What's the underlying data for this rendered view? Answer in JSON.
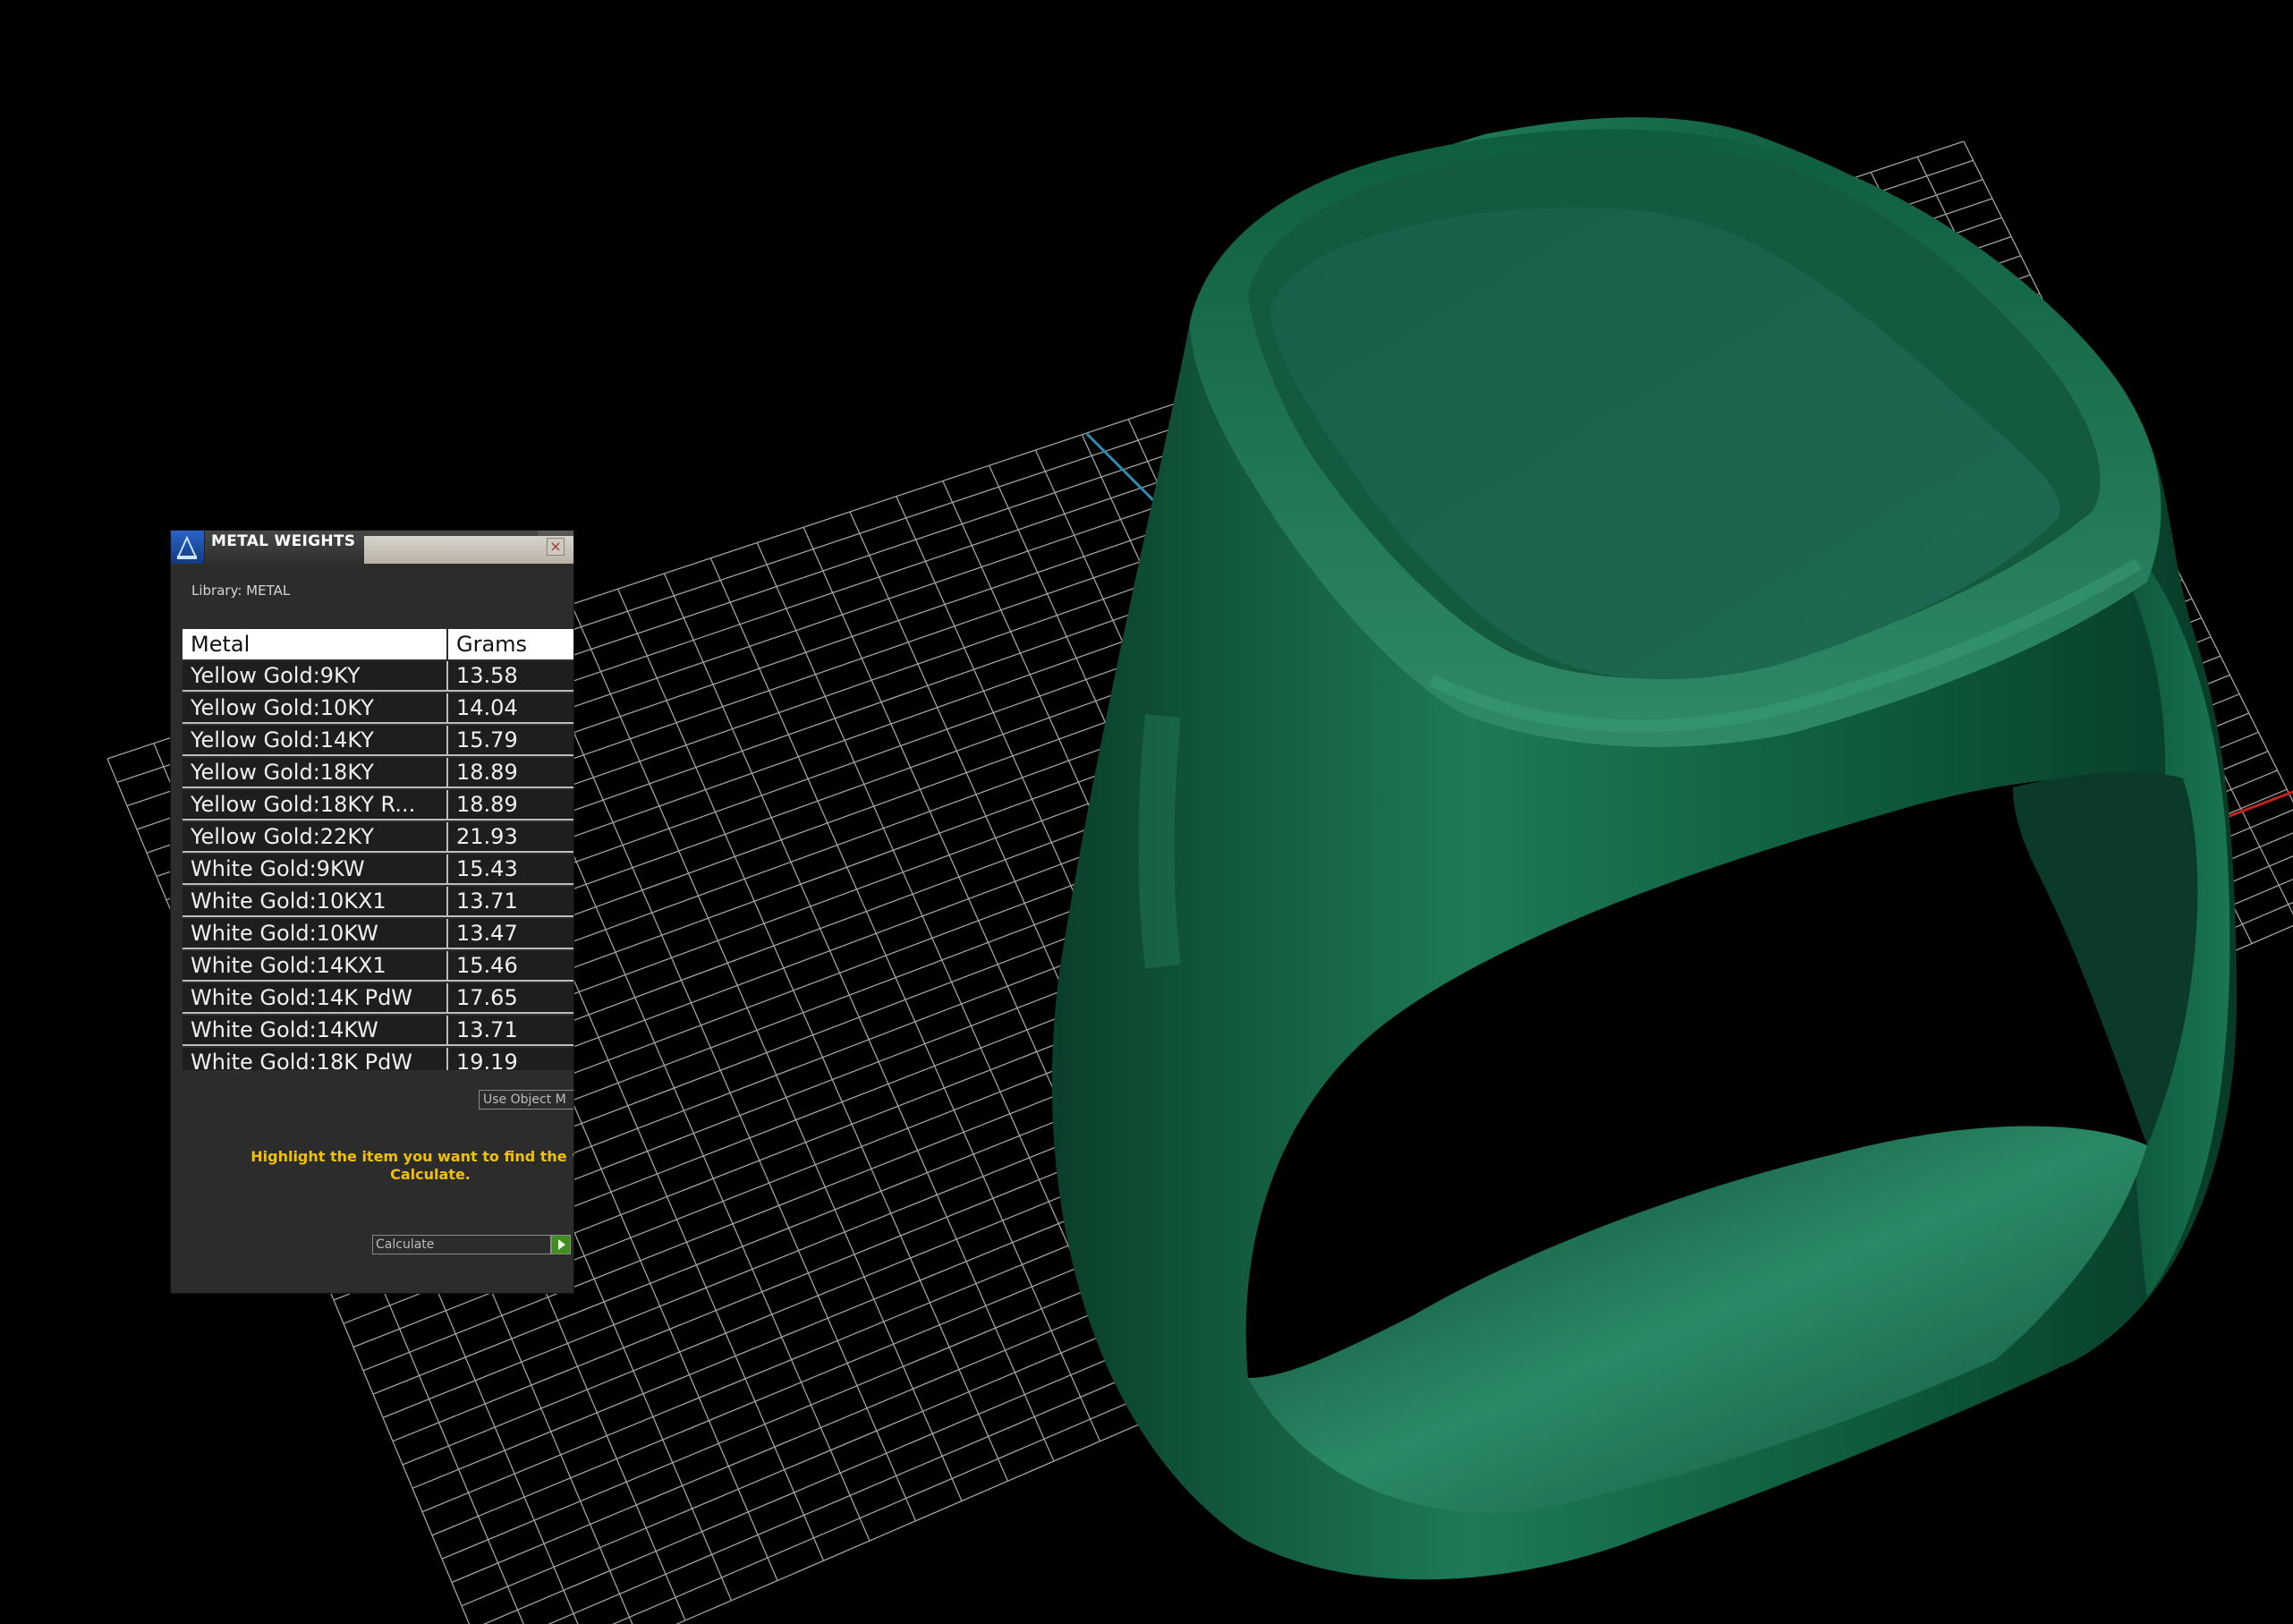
{
  "panel": {
    "title": "METAL WEIGHTS",
    "close_glyph": "×",
    "library_label": "Library: METAL",
    "columns": {
      "metal": "Metal",
      "grams": "Grams"
    },
    "rows": [
      {
        "metal": "Yellow Gold:9KY",
        "grams": "13.58"
      },
      {
        "metal": "Yellow Gold:10KY",
        "grams": "14.04"
      },
      {
        "metal": "Yellow Gold:14KY",
        "grams": "15.79"
      },
      {
        "metal": "Yellow Gold:18KY",
        "grams": "18.89"
      },
      {
        "metal": "Yellow Gold:18KY R...",
        "grams": "18.89"
      },
      {
        "metal": "Yellow Gold:22KY",
        "grams": "21.93"
      },
      {
        "metal": "White Gold:9KW",
        "grams": "15.43"
      },
      {
        "metal": "White Gold:10KX1",
        "grams": "13.71"
      },
      {
        "metal": "White Gold:10KW",
        "grams": "13.47"
      },
      {
        "metal": "White Gold:14KX1",
        "grams": "15.46"
      },
      {
        "metal": "White Gold:14K PdW",
        "grams": "17.65"
      },
      {
        "metal": "White Gold:14KW",
        "grams": "13.71"
      },
      {
        "metal": "White Gold:18K PdW",
        "grams": "19.19"
      }
    ],
    "use_object_button": "Use Object M",
    "hint_line1": "Highlight the item you want to find the weig",
    "hint_line2": "Calculate.",
    "calculate_field": "Calculate"
  },
  "viewport": {
    "model_color": "#0b5a3b",
    "grid_color": "#bfbfbf",
    "axis_x_color": "#c0221c",
    "axis_y_color": "#2c8fb0"
  }
}
